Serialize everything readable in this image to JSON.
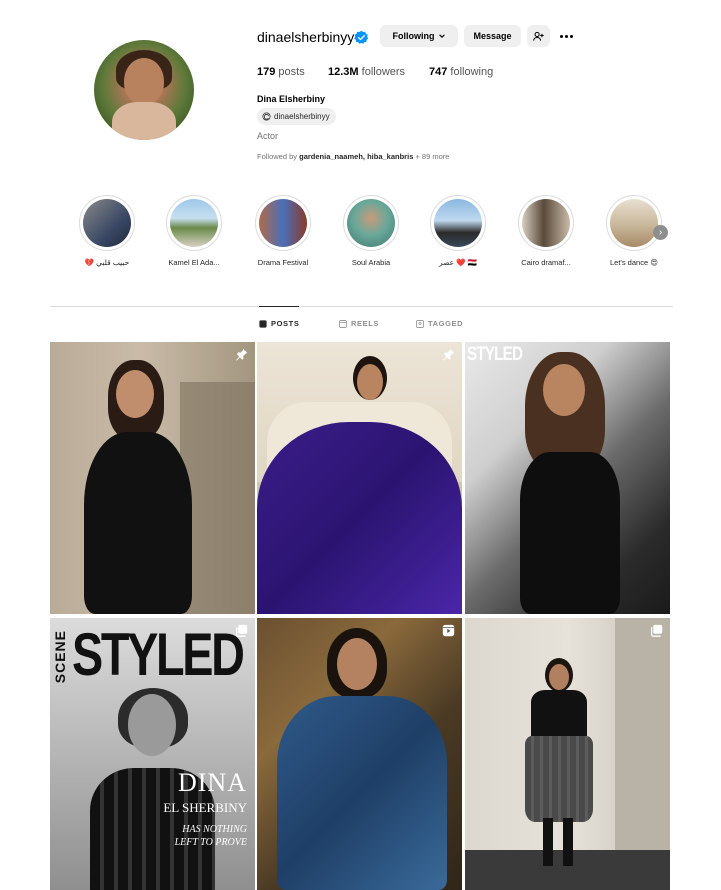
{
  "profile": {
    "username": "dinaelsherbinyy",
    "following_label": "Following",
    "message_label": "Message",
    "posts_count": "179",
    "posts_label": "posts",
    "followers_count": "12.3M",
    "followers_label": "followers",
    "following_count": "747",
    "following_stat_label": "following",
    "full_name": "Dina Elsherbiny",
    "threads_handle": "dinaelsherbinyy",
    "category": "Actor",
    "followed_by_prefix": "Followed by",
    "followed_by_user1": "gardenia_naameh",
    "followed_by_sep": ",",
    "followed_by_user2": "hiba_kanbris",
    "followed_by_more": "+ 89 more"
  },
  "highlights": [
    {
      "label": "💔 حبيب قلبي"
    },
    {
      "label": "Kamel El Ada..."
    },
    {
      "label": "Drama Festival"
    },
    {
      "label": "Soul Arabia"
    },
    {
      "label": "عصر ❤️ 🇪🇬"
    },
    {
      "label": "Cairo dramaf..."
    },
    {
      "label": "Let's dance 😍"
    }
  ],
  "tabs": [
    {
      "label": "POSTS",
      "active": true
    },
    {
      "label": "REELS",
      "active": false
    },
    {
      "label": "TAGGED",
      "active": false
    }
  ],
  "posts": {
    "p3_overlay": "STYLED",
    "p4_scene": "SCENE",
    "p4_title": "STYLED",
    "p4_name": "DINA",
    "p4_surname": "EL SHERBINY",
    "p4_tag1": "HAS NOTHING",
    "p4_tag2": "LEFT TO PROVE"
  },
  "colors": {
    "verified": "#0095f6",
    "button_bg": "#efefef",
    "text_primary": "#262626",
    "text_secondary": "#737373"
  },
  "icons": {
    "verified": "verified-badge-icon",
    "chevron": "chevron-down-icon",
    "add_user": "add-user-icon",
    "more": "more-icon",
    "threads": "threads-icon",
    "next": "chevron-right-icon",
    "pin": "pin-icon",
    "reel": "reel-icon",
    "carousel": "carousel-icon"
  }
}
